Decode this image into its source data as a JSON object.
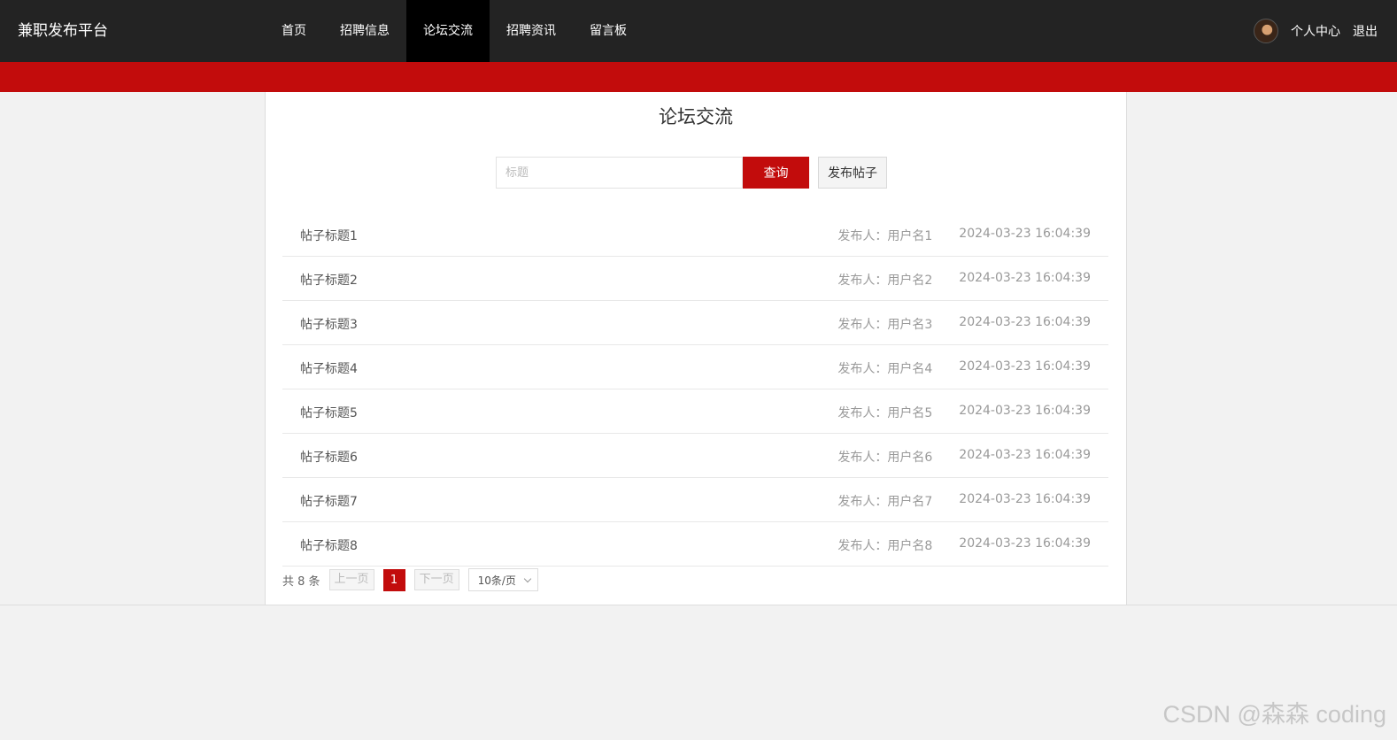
{
  "header": {
    "brand": "兼职发布平台",
    "nav": [
      {
        "label": "首页",
        "active": false
      },
      {
        "label": "招聘信息",
        "active": false
      },
      {
        "label": "论坛交流",
        "active": true
      },
      {
        "label": "招聘资讯",
        "active": false
      },
      {
        "label": "留言板",
        "active": false
      }
    ],
    "user_center": "个人中心",
    "logout": "退出"
  },
  "main": {
    "title": "论坛交流",
    "search": {
      "placeholder": "标题",
      "value": ""
    },
    "query_button": "查询",
    "post_button": "发布帖子",
    "posts": [
      {
        "title": "帖子标题1",
        "author": "发布人：用户名1",
        "time": "2024-03-23 16:04:39"
      },
      {
        "title": "帖子标题2",
        "author": "发布人：用户名2",
        "time": "2024-03-23 16:04:39"
      },
      {
        "title": "帖子标题3",
        "author": "发布人：用户名3",
        "time": "2024-03-23 16:04:39"
      },
      {
        "title": "帖子标题4",
        "author": "发布人：用户名4",
        "time": "2024-03-23 16:04:39"
      },
      {
        "title": "帖子标题5",
        "author": "发布人：用户名5",
        "time": "2024-03-23 16:04:39"
      },
      {
        "title": "帖子标题6",
        "author": "发布人：用户名6",
        "time": "2024-03-23 16:04:39"
      },
      {
        "title": "帖子标题7",
        "author": "发布人：用户名7",
        "time": "2024-03-23 16:04:39"
      },
      {
        "title": "帖子标题8",
        "author": "发布人：用户名8",
        "time": "2024-03-23 16:04:39"
      }
    ],
    "pagination": {
      "total": "共 8 条",
      "prev": "上一页",
      "current": "1",
      "next": "下一页",
      "page_size": "10条/页"
    }
  },
  "watermark": "CSDN @森森 coding",
  "colors": {
    "accent": "#c20c0c",
    "header_bg": "#232323",
    "active_nav": "#000000"
  }
}
